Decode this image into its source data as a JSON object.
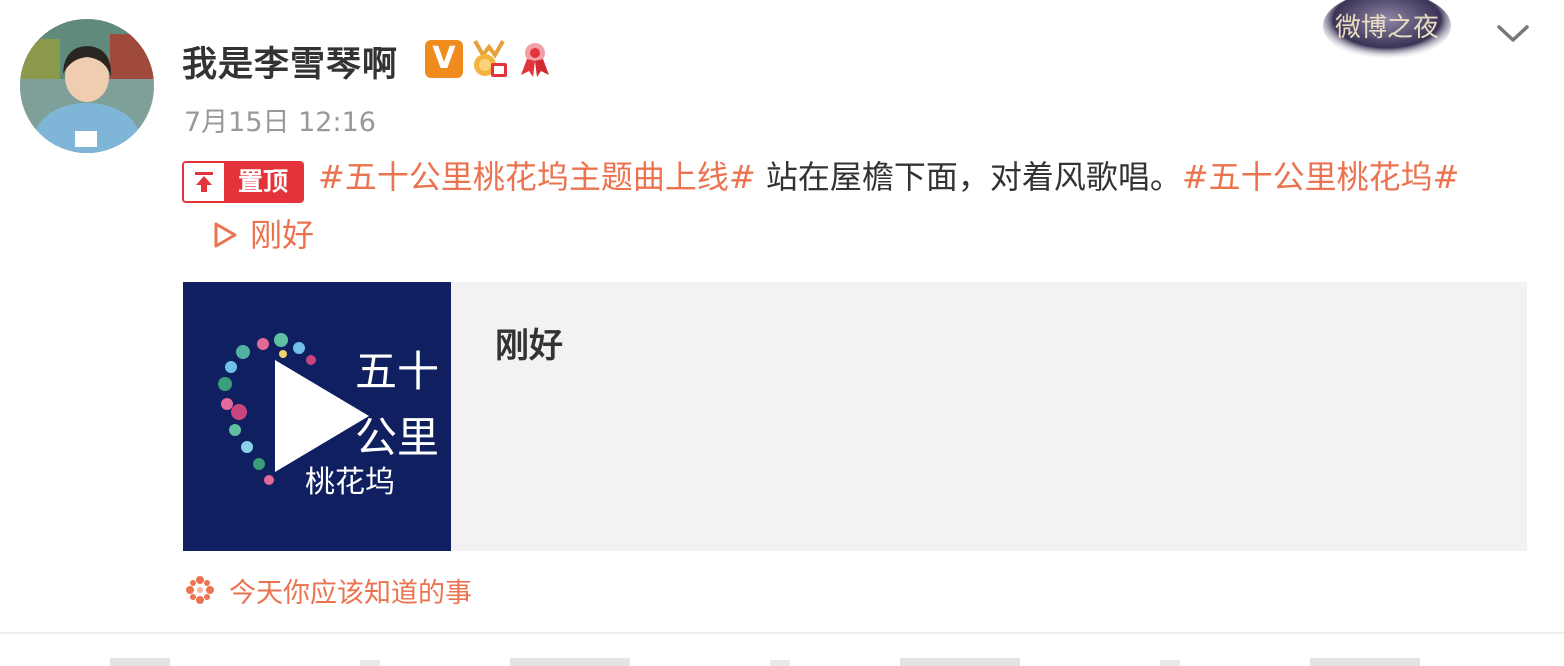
{
  "post": {
    "author_name": "我是李雪琴啊",
    "timestamp": "7月15日 12:16",
    "pin_label": "置顶",
    "body": {
      "topic1": "#五十公里桃花坞主题曲上线#",
      "text": " 站在屋檐下面，对着风歌唱。",
      "topic2": "#五十公里桃花坞#",
      "play_link": "刚好"
    },
    "card": {
      "title": "刚好",
      "cover_text_line1": "五十",
      "cover_text_line2": "公里",
      "cover_text_line3": "桃花坞"
    },
    "footer_tag": "今天你应该知道的事",
    "event_logo_text": "微博之夜"
  },
  "colors": {
    "accent_link": "#eb7350",
    "pin_red": "#e5333c",
    "verified_orange": "#f08b1d",
    "cover_navy": "#0f1f5f"
  },
  "icons": [
    "verified-v-icon",
    "gold-medal-icon",
    "ribbon-badge-icon",
    "chevron-down-icon",
    "pin-top-icon",
    "play-icon",
    "flower-icon"
  ]
}
